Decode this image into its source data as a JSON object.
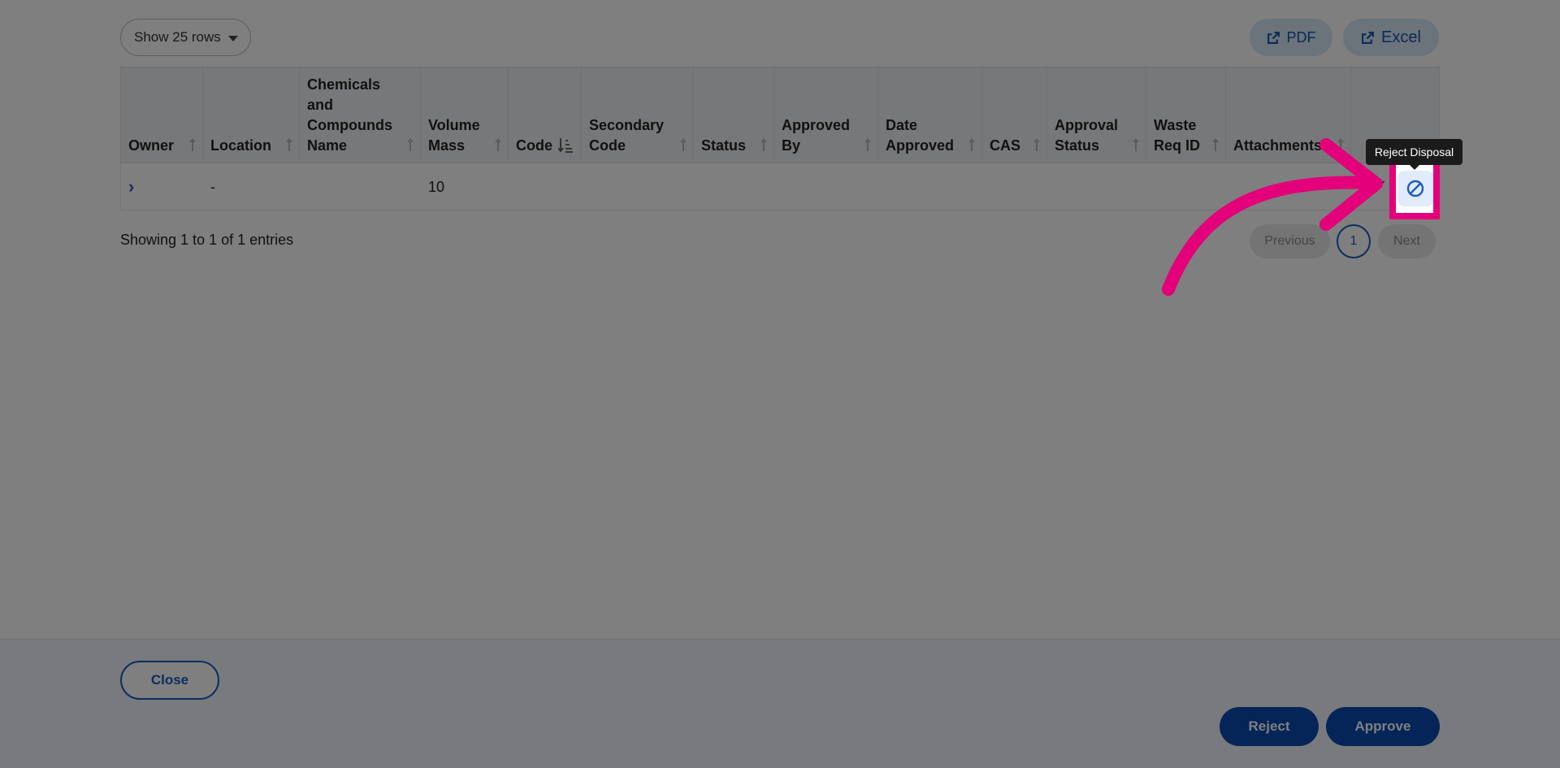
{
  "toolbar": {
    "rows_select_label": "Show 25 rows",
    "pdf_label": "PDF",
    "excel_label": "Excel"
  },
  "table": {
    "columns": [
      "Owner",
      "Location",
      "Chemicals and Compounds Name",
      "Volume Mass",
      "Code",
      "Secondary Code",
      "Status",
      "Approved By",
      "Date Approved",
      "CAS",
      "Approval Status",
      "Waste Req ID",
      "Attachments"
    ],
    "rows": [
      {
        "owner": "",
        "location": "-",
        "chemicals": "",
        "volume_mass": "10",
        "code": "",
        "secondary_code": "",
        "status": "",
        "approved_by": "",
        "date_approved": "",
        "cas": "",
        "approval_status": "",
        "waste_req_id": "",
        "attachments": ""
      }
    ]
  },
  "tooltip": {
    "text": "Reject Disposal"
  },
  "entries_info": "Showing 1 to 1 of 1 entries",
  "pagination": {
    "previous_label": "Previous",
    "current_page": "1",
    "next_label": "Next"
  },
  "footer": {
    "close_label": "Close",
    "reject_label": "Reject",
    "approve_label": "Approve"
  },
  "colors": {
    "accent": "#1b5cc0",
    "primary_button": "#0a4bb0",
    "highlight": "#e3007a"
  },
  "icons": {
    "export": "external-link-icon",
    "expand": "chevron-right-icon",
    "approve": "check-icon",
    "reject": "ban-icon",
    "sort": "sort-arrows-icon"
  }
}
